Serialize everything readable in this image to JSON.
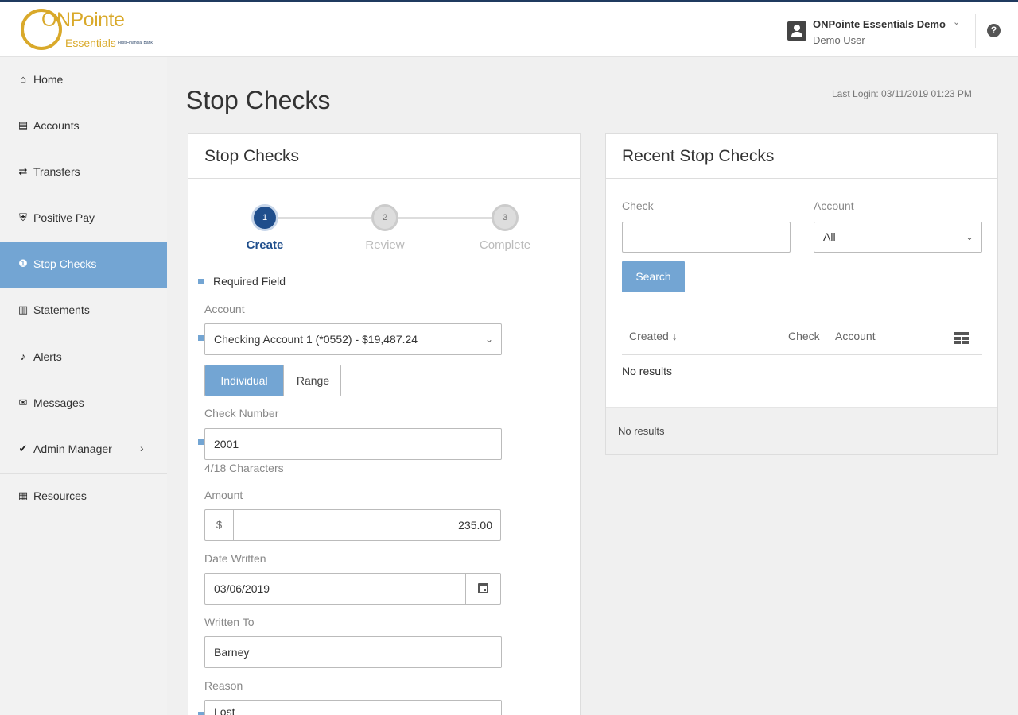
{
  "brand": {
    "logo_main": "ONPointe",
    "logo_sub": "Essentials",
    "logo_tiny": "First Financial Bank",
    "logo_color": "#d9a92a"
  },
  "header": {
    "org_name": "ONPointe Essentials Demo",
    "user_name": "Demo User",
    "help_icon": "?",
    "org_chevron": "⌄"
  },
  "colors": {
    "accent": "#73a5d3",
    "primary_dark": "#1f4e8c",
    "top_bar": "#1f3a5f"
  },
  "sidebar": {
    "items": [
      {
        "label": "Home",
        "icon": "home-icon",
        "glyph": "⌂"
      },
      {
        "label": "Accounts",
        "icon": "accounts-icon",
        "glyph": "▤"
      },
      {
        "label": "Transfers",
        "icon": "transfers-icon",
        "glyph": "⇄"
      },
      {
        "label": "Positive Pay",
        "icon": "shield-icon",
        "glyph": "⛨"
      },
      {
        "label": "Stop Checks",
        "icon": "alert-circle-icon",
        "glyph": "❶",
        "active": true
      },
      {
        "label": "Statements",
        "icon": "document-icon",
        "glyph": "▥"
      },
      {
        "label": "Alerts",
        "icon": "bell-icon",
        "glyph": "♪"
      },
      {
        "label": "Messages",
        "icon": "envelope-icon",
        "glyph": "✉"
      },
      {
        "label": "Admin Manager",
        "icon": "check-badge-icon",
        "glyph": "✔",
        "chevron": "›"
      },
      {
        "label": "Resources",
        "icon": "book-icon",
        "glyph": "▦"
      }
    ]
  },
  "page": {
    "title": "Stop Checks",
    "last_login": "Last Login: 03/11/2019 01:23 PM"
  },
  "form": {
    "panel_title": "Stop Checks",
    "steps": [
      {
        "number": "1",
        "label": "Create",
        "active": true
      },
      {
        "number": "2",
        "label": "Review",
        "active": false
      },
      {
        "number": "3",
        "label": "Complete",
        "active": false
      }
    ],
    "required_note": "Required Field",
    "account_label": "Account",
    "account_value": "Checking Account 1 (*0552) - $19,487.24",
    "mode_individual": "Individual",
    "mode_range": "Range",
    "check_number_label": "Check Number",
    "check_number_value": "2001",
    "check_number_hint": "4/18 Characters",
    "amount_label": "Amount",
    "amount_prefix": "$",
    "amount_value": "235.00",
    "date_label": "Date Written",
    "date_value": "03/06/2019",
    "written_to_label": "Written To",
    "written_to_value": "Barney",
    "reason_label": "Reason",
    "reason_value": "Lost",
    "select_chevron": "⌄"
  },
  "recent": {
    "panel_title": "Recent Stop Checks",
    "check_label": "Check",
    "check_value": "",
    "account_label": "Account",
    "account_value": "All",
    "search_label": "Search",
    "columns": [
      {
        "label": "Created ↓"
      },
      {
        "label": "Check"
      },
      {
        "label": "Account"
      }
    ],
    "no_results": "No results",
    "footer_text": "No results"
  }
}
